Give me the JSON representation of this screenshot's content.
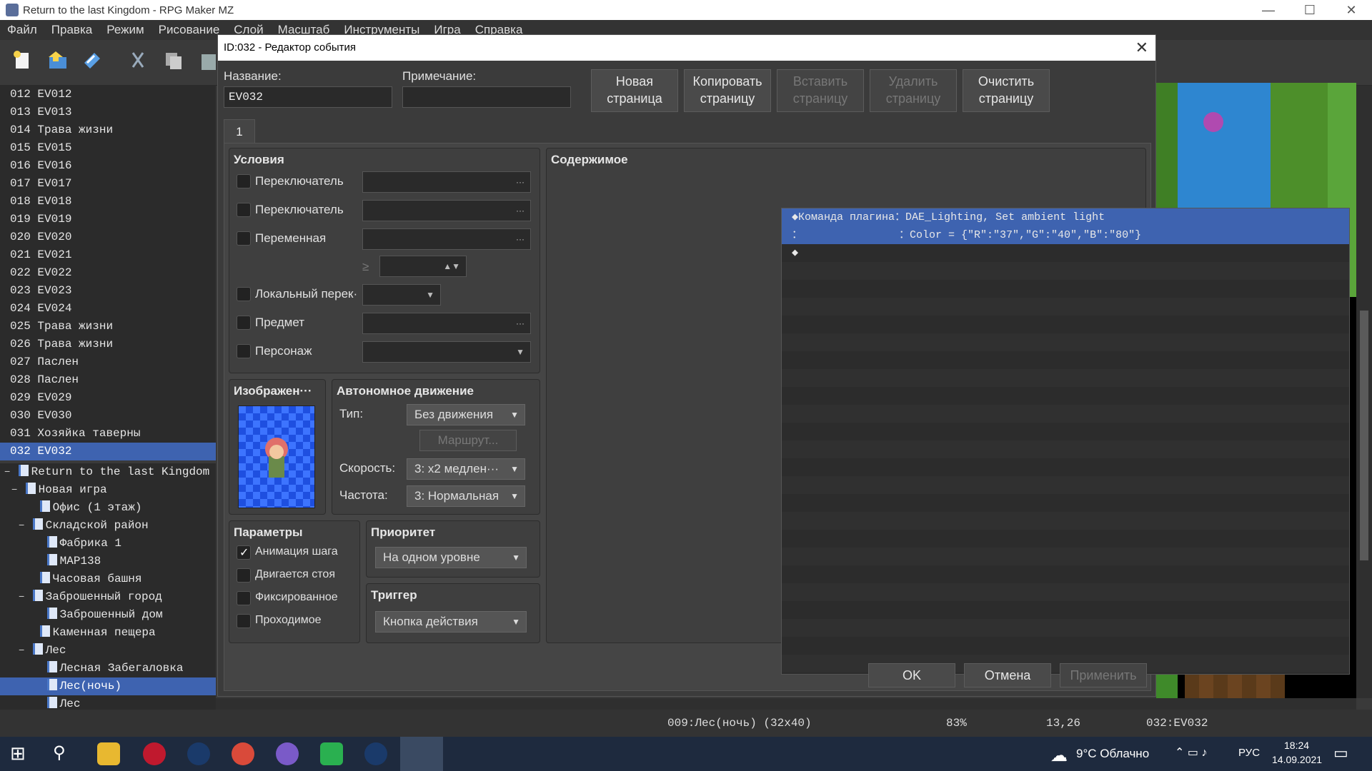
{
  "window": {
    "title": "Return to the last Kingdom - RPG Maker MZ",
    "min": "—",
    "max": "☐",
    "close": "✕"
  },
  "menubar": [
    "Файл",
    "Правка",
    "Режим",
    "Рисование",
    "Слой",
    "Масштаб",
    "Инструменты",
    "Игра",
    "Справка"
  ],
  "events": [
    {
      "id": "012",
      "name": "EV012"
    },
    {
      "id": "013",
      "name": "EV013"
    },
    {
      "id": "014",
      "name": "Трава жизни"
    },
    {
      "id": "015",
      "name": "EV015"
    },
    {
      "id": "016",
      "name": "EV016"
    },
    {
      "id": "017",
      "name": "EV017"
    },
    {
      "id": "018",
      "name": "EV018"
    },
    {
      "id": "019",
      "name": "EV019"
    },
    {
      "id": "020",
      "name": "EV020"
    },
    {
      "id": "021",
      "name": "EV021"
    },
    {
      "id": "022",
      "name": "EV022"
    },
    {
      "id": "023",
      "name": "EV023"
    },
    {
      "id": "024",
      "name": "EV024"
    },
    {
      "id": "025",
      "name": "Трава жизни"
    },
    {
      "id": "026",
      "name": "Трава жизни"
    },
    {
      "id": "027",
      "name": "Паслен"
    },
    {
      "id": "028",
      "name": "Паслен"
    },
    {
      "id": "029",
      "name": "EV029"
    },
    {
      "id": "030",
      "name": "EV030"
    },
    {
      "id": "031",
      "name": "Хозяйка таверны"
    },
    {
      "id": "032",
      "name": "EV032"
    }
  ],
  "maps": [
    {
      "name": "Return to the last Kingdom",
      "indent": 0,
      "toggle": "−"
    },
    {
      "name": "Новая игра",
      "indent": 1,
      "toggle": "−"
    },
    {
      "name": "Офис (1 этаж)",
      "indent": 2,
      "toggle": ""
    },
    {
      "name": "Складской район",
      "indent": 2,
      "toggle": "−"
    },
    {
      "name": "Фабрика 1",
      "indent": 3,
      "toggle": ""
    },
    {
      "name": "MAP138",
      "indent": 3,
      "toggle": ""
    },
    {
      "name": "Часовая башня",
      "indent": 2,
      "toggle": ""
    },
    {
      "name": "Заброшенный город",
      "indent": 2,
      "toggle": "−"
    },
    {
      "name": "Заброшенный дом",
      "indent": 3,
      "toggle": ""
    },
    {
      "name": "Каменная пещера",
      "indent": 2,
      "toggle": ""
    },
    {
      "name": "Лес",
      "indent": 2,
      "toggle": "−"
    },
    {
      "name": "Лесная Забегаловка",
      "indent": 3,
      "toggle": ""
    },
    {
      "name": "Лес(ночь)",
      "indent": 3,
      "toggle": ""
    },
    {
      "name": "Лес",
      "indent": 3,
      "toggle": ""
    }
  ],
  "dialog": {
    "title": "ID:032 - Редактор события",
    "close": "✕",
    "name_label": "Название:",
    "name_value": "EV032",
    "note_label": "Примечание:",
    "note_value": "",
    "btn_new": [
      "Новая",
      "страница"
    ],
    "btn_copy": [
      "Копировать",
      "страницу"
    ],
    "btn_paste": [
      "Вставить",
      "страницу"
    ],
    "btn_delete": [
      "Удалить",
      "страницу"
    ],
    "btn_clear": [
      "Очистить",
      "страницу"
    ],
    "tab": "1",
    "conditions_title": "Условия",
    "conditions": [
      "Переключатель",
      "Переключатель",
      "Переменная",
      "Локальный перек·",
      "Предмет",
      "Персонаж"
    ],
    "dots": "···",
    "gte": "≥",
    "image_title": "Изображен···",
    "move_title": "Автономное движение",
    "move_type_label": "Тип:",
    "move_type": "Без движения",
    "route_btn": "Маршрут...",
    "speed_label": "Скорость:",
    "speed": "3: x2 медлен···",
    "freq_label": "Частота:",
    "freq": "3: Нормальная",
    "params_title": "Параметры",
    "params": [
      {
        "label": "Анимация шага",
        "checked": true
      },
      {
        "label": "Двигается стоя",
        "checked": false
      },
      {
        "label": "Фиксированное",
        "checked": false
      },
      {
        "label": "Проходимое",
        "checked": false
      }
    ],
    "priority_title": "Приоритет",
    "priority": "На одном уровне",
    "trigger_title": "Триггер",
    "trigger": "Кнопка действия",
    "content_title": "Содержимое",
    "content_lines": [
      "◆Команда плагина：DAE_Lighting, Set ambient light",
      "：               ：Color = {\"R\":\"37\",\"G\":\"40\",\"B\":\"80\"}",
      "◆"
    ],
    "ok": "OK",
    "cancel": "Отмена",
    "apply": "Применить"
  },
  "status": {
    "map": "009:Лес(ночь) (32x40)",
    "zoom": "83%",
    "coords": "13,26",
    "event": "032:EV032"
  },
  "taskbar": {
    "weather": "9°C  Облачно",
    "lang": "РУС",
    "time": "18:24",
    "date": "14.09.2021"
  },
  "colors": {
    "selection": "#3e63b0",
    "dialog_bg": "#3b3b3b",
    "panel_bg": "#3f3f3f"
  }
}
